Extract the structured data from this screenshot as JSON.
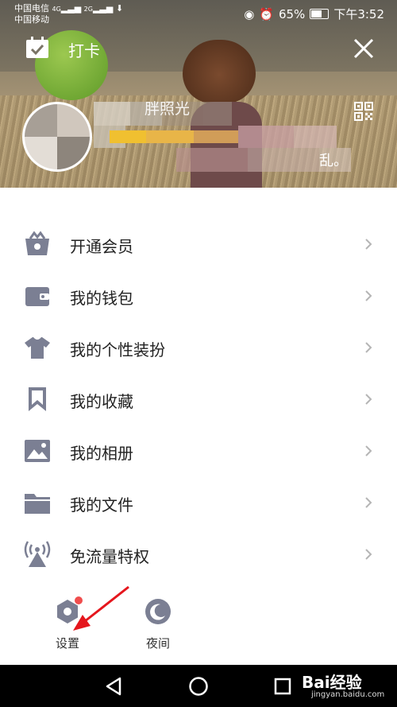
{
  "status_bar": {
    "carrier_1": "中国电信",
    "carrier_2": "中国移动",
    "net_1": "4G",
    "net_2": "2G",
    "battery": "65%",
    "time": "下午3:52"
  },
  "header": {
    "title": "打卡",
    "nickname_fragment": " 胖照光",
    "signature_fragment": "乱。"
  },
  "menu": [
    {
      "label": "开通会员",
      "icon": "vip-basket-icon"
    },
    {
      "label": "我的钱包",
      "icon": "wallet-icon"
    },
    {
      "label": "我的个性装扮",
      "icon": "tshirt-icon"
    },
    {
      "label": "我的收藏",
      "icon": "bookmark-icon"
    },
    {
      "label": "我的相册",
      "icon": "photo-icon"
    },
    {
      "label": "我的文件",
      "icon": "folder-icon"
    },
    {
      "label": "免流量特权",
      "icon": "signal-tower-icon"
    }
  ],
  "bottom": {
    "settings_label": "设置",
    "night_label": "夜间"
  },
  "watermark": {
    "brand": "Bai经验",
    "url": "jingyan.baidu.com"
  },
  "colors": {
    "icon_gray": "#7b7f93",
    "badge_red": "#f04d4d",
    "annotation_red": "#e5161d"
  }
}
